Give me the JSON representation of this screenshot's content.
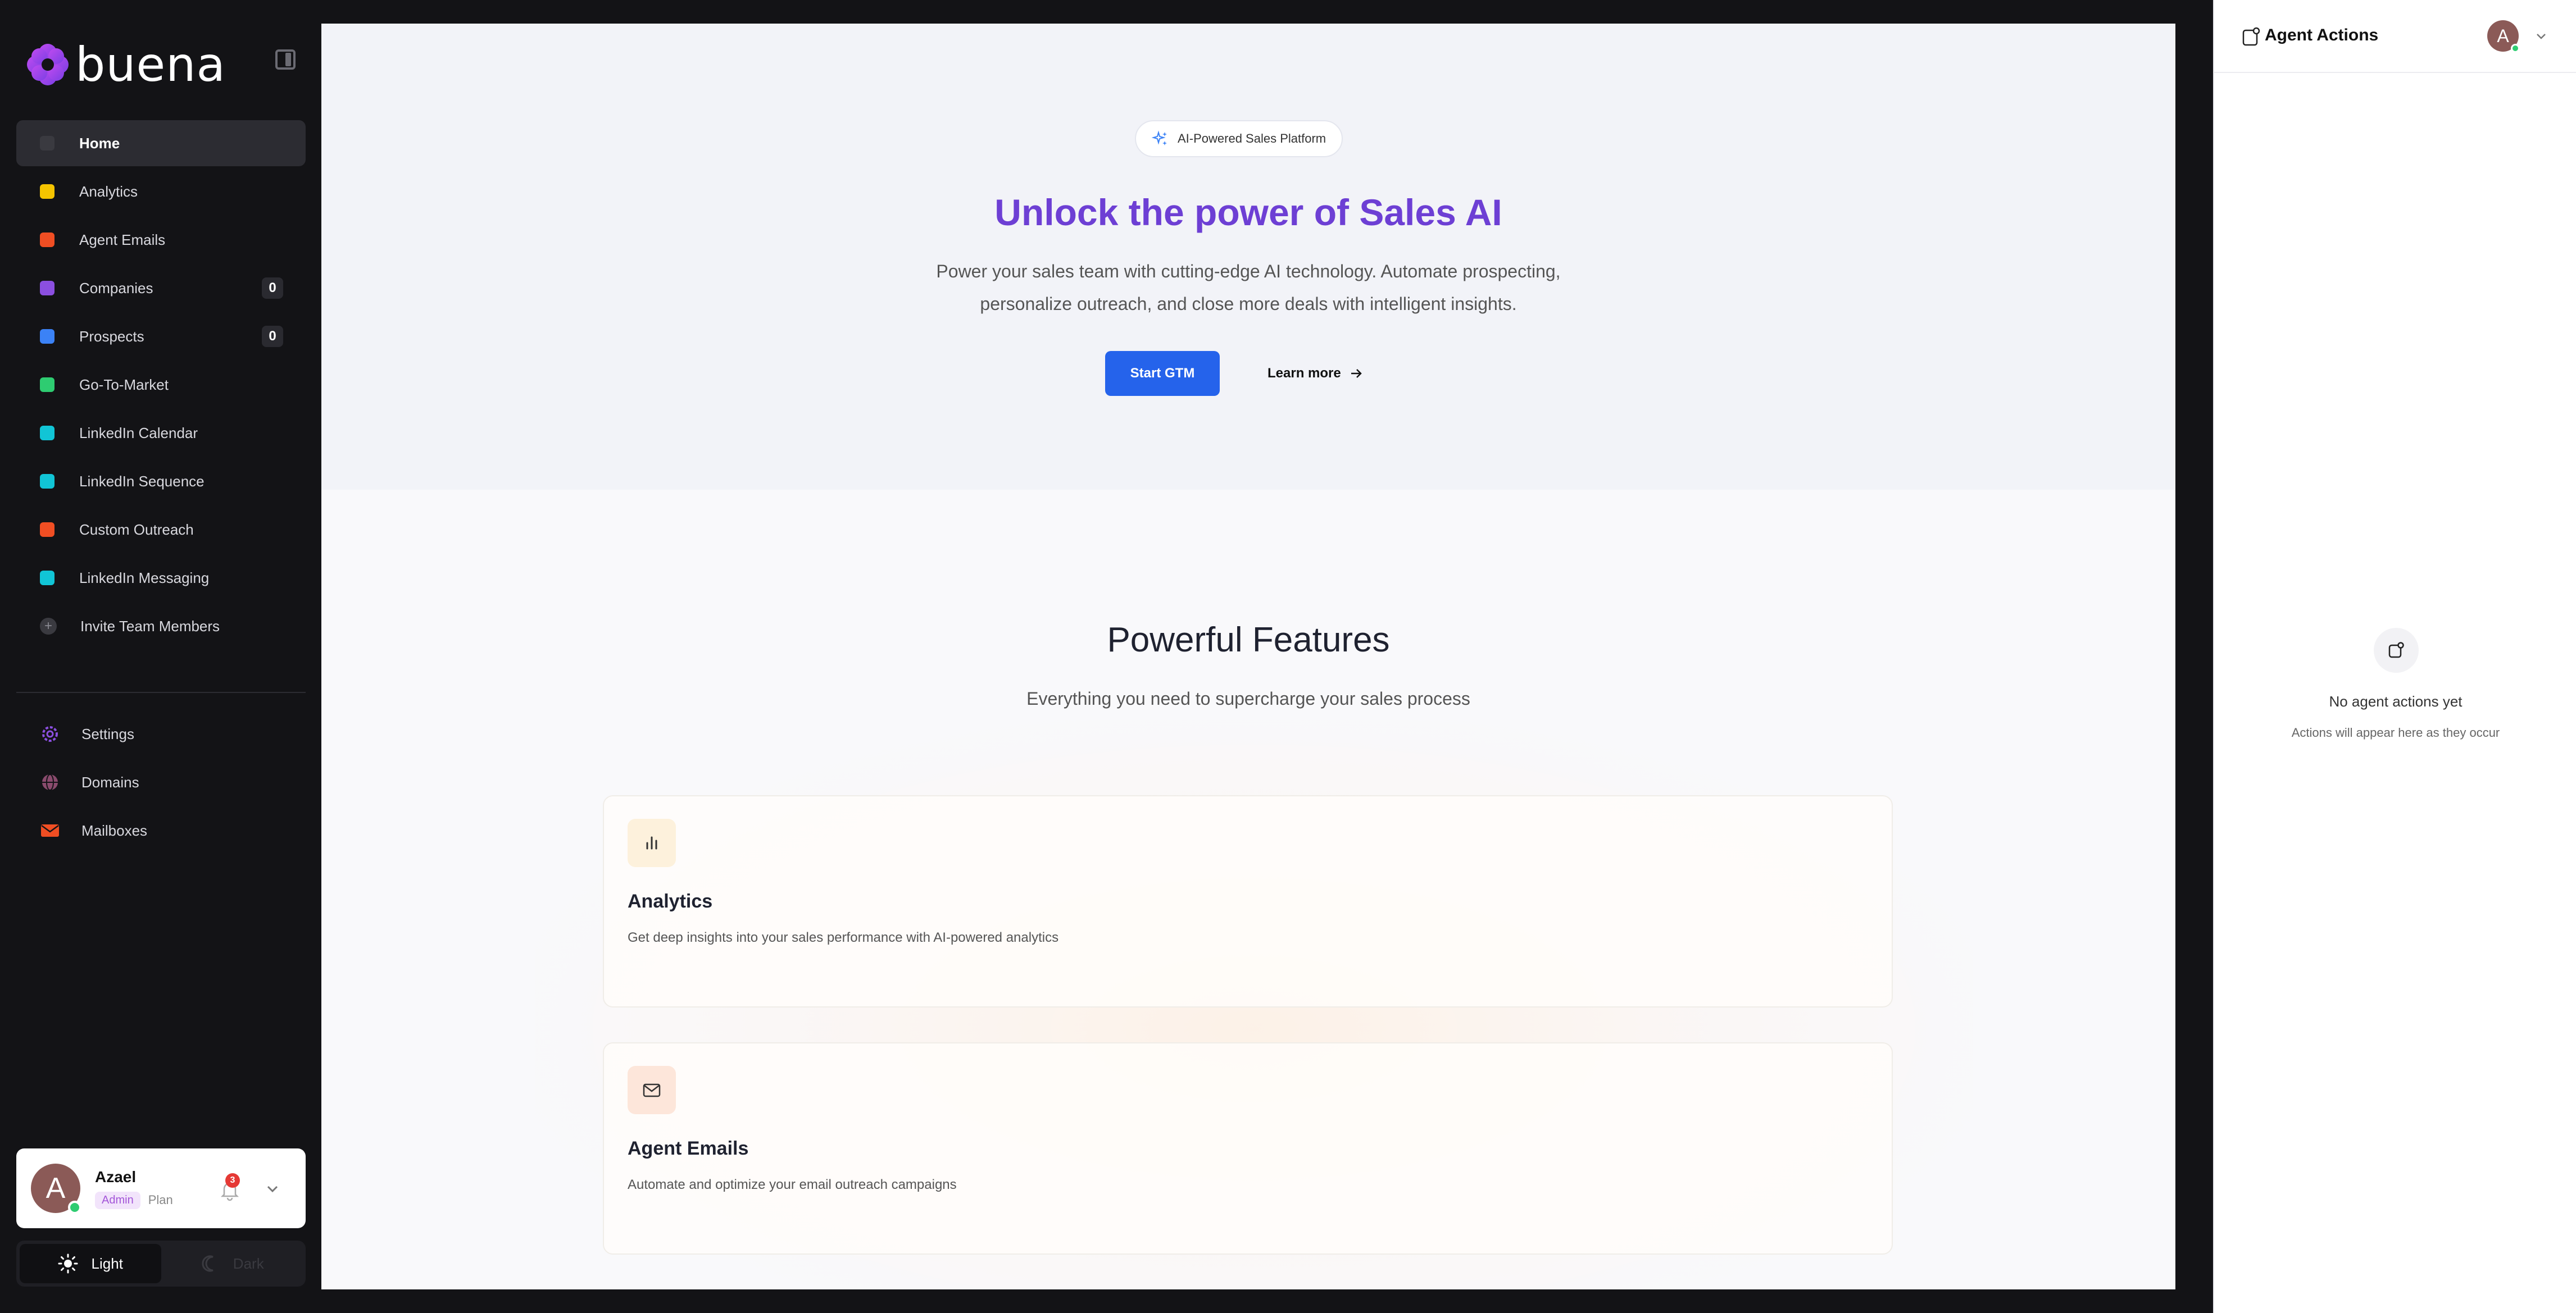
{
  "brand": {
    "name": "buena"
  },
  "sidebar": {
    "items": [
      {
        "label": "Home",
        "color": "#3a3a40",
        "active": true
      },
      {
        "label": "Analytics",
        "color": "#f5c400"
      },
      {
        "label": "Agent Emails",
        "color": "#f04e23"
      },
      {
        "label": "Companies",
        "color": "#8b4fe0",
        "count": "0"
      },
      {
        "label": "Prospects",
        "color": "#3b82f6",
        "count": "0"
      },
      {
        "label": "Go-To-Market",
        "color": "#2ecc71"
      },
      {
        "label": "LinkedIn Calendar",
        "color": "#11c5d6"
      },
      {
        "label": "LinkedIn Sequence",
        "color": "#11c5d6"
      },
      {
        "label": "Custom Outreach",
        "color": "#f04e23"
      },
      {
        "label": "LinkedIn Messaging",
        "color": "#11c5d6"
      },
      {
        "label": "Invite Team Members",
        "icon": "plus-icon"
      }
    ],
    "bottom_items": [
      {
        "label": "Settings",
        "icon": "gear-icon",
        "color": "#8b4fe0"
      },
      {
        "label": "Domains",
        "icon": "globe-icon",
        "color": "#8a4b6d"
      },
      {
        "label": "Mailboxes",
        "icon": "mail-icon",
        "color": "#f04e23"
      }
    ],
    "user": {
      "name": "Azael",
      "initial": "A",
      "role": "Admin",
      "plan": "Plan",
      "notifications": "3"
    },
    "theme": {
      "light": "Light",
      "dark": "Dark"
    }
  },
  "hero": {
    "badge": "AI-Powered Sales Platform",
    "title": "Unlock the power of Sales AI",
    "subtitle_line1": "Power your sales team with cutting-edge AI technology. Automate prospecting,",
    "subtitle_line2": "personalize outreach, and close more deals with intelligent insights.",
    "primary_button": "Start GTM",
    "secondary_button": "Learn more"
  },
  "features": {
    "title": "Powerful Features",
    "subtitle": "Everything you need to supercharge your sales process",
    "cards": [
      {
        "title": "Analytics",
        "description": "Get deep insights into your sales performance with AI-powered analytics",
        "icon": "bar-chart-icon",
        "icon_bg": "#fdf1dc"
      },
      {
        "title": "Agent Emails",
        "description": "Automate and optimize your email outreach campaigns",
        "icon": "mail-icon",
        "icon_bg": "#fde6da"
      }
    ]
  },
  "panel": {
    "title": "Agent Actions",
    "avatar_initial": "A",
    "empty_title": "No agent actions yet",
    "empty_subtitle": "Actions will appear here as they occur"
  }
}
